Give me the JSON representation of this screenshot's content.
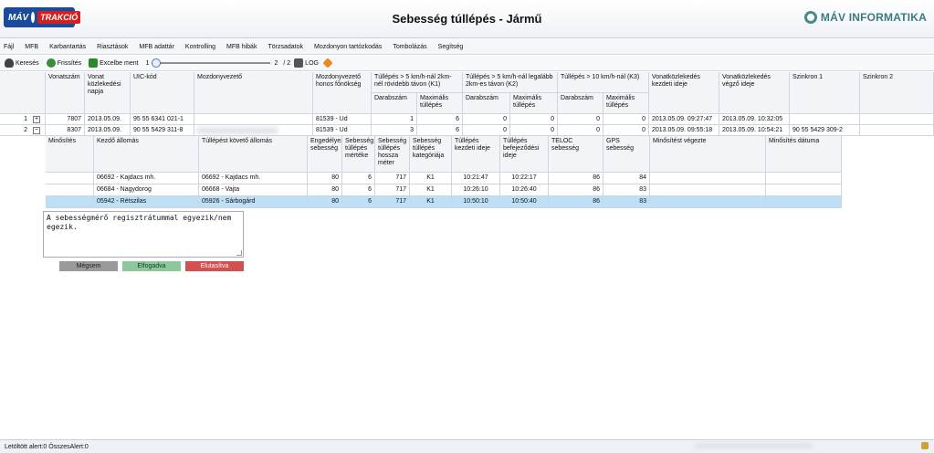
{
  "header": {
    "logo_left_mav": "MÁV",
    "logo_left_trakcio": "TRAKCIÓ",
    "title": "Sebesség túllépés - Jármű",
    "logo_right": "MÁV INFORMATIKA"
  },
  "menu": [
    "Fájl",
    "MFB",
    "Karbantartás",
    "Riasztások",
    "MFB adattár",
    "Kontrolling",
    "MFB hibák",
    "Törzsadatok",
    "Mozdonyon tartózkodás",
    "Tombolázás",
    "Segítség"
  ],
  "toolbar": {
    "search": "Keresés",
    "refresh": "Frissítés",
    "excel": "Excelbe ment",
    "page_current": "1",
    "page_total": "2",
    "page_of": "/ 2",
    "log": "LOG"
  },
  "main_grid": {
    "headers": {
      "vonatszam": "Vonatszám",
      "vonat_napja": "Vonat közlekedési napja",
      "uic": "UIC-kód",
      "mozdonyvezeto": "Mozdonyvezető",
      "fonokseg": "Mozdonyvezető honos főnökség",
      "k1_group": "Túllépés > 5 km/h-nál 2km-nél rövidebb távon (K1)",
      "k2_group": "Túllépés > 5 km/h-nál legalább 2km-es távon (K2)",
      "k3_group": "Túllépés > 10 km/h-nál (K3)",
      "darabszam": "Darabszám",
      "max_tullepes": "Maximális túllépés",
      "kezdeti": "Vonatközlekedés kezdeti ideje",
      "vegzo": "Vonatközlekedés végző ideje",
      "szinkron1": "Szinkron 1",
      "szinkron2": "Szinkron 2"
    },
    "rows": [
      {
        "num": "1",
        "expander": "+",
        "vonatszam": "7807",
        "nap": "2013.05.09.",
        "uic": "95 55 6341 021-1",
        "fonokseg": "81539 - Ud",
        "k1_db": "1",
        "k1_max": "6",
        "k2_db": "0",
        "k2_max": "0",
        "k3_db": "0",
        "k3_max": "0",
        "kezdeti": "2013.05.09. 09:27:47",
        "vegzo": "2013.05.09. 10:32:05",
        "szinkron1": "",
        "szinkron2": ""
      },
      {
        "num": "2",
        "expander": "−",
        "vonatszam": "8307",
        "nap": "2013.05.09.",
        "uic": "90 55 5429 311-8",
        "fonokseg": "81539 - Ud",
        "k1_db": "3",
        "k1_max": "6",
        "k2_db": "0",
        "k2_max": "0",
        "k3_db": "0",
        "k3_max": "0",
        "kezdeti": "2013.05.09. 09:55:18",
        "vegzo": "2013.05.09. 10:54:21",
        "szinkron1": "90 55 5429 309-2",
        "szinkron2": ""
      }
    ]
  },
  "detail_grid": {
    "headers": {
      "minosites": "Minősítés",
      "kezdo": "Kezdő állomás",
      "koveto": "Túllépést követő állomás",
      "engedelyezett": "Engedélyezett sebesség",
      "mertek": "Sebesség túllépés mértéke",
      "hossz": "Sebesség túllépés hossza méter",
      "kategoria": "Sebesség túllépés kategóriája",
      "kezdeti": "Túllépés kezdeti ideje",
      "befejezo": "Túllépés befejeződési ideje",
      "teloc": "TELOC sebesség",
      "gps": "GPS sebesség",
      "vegezte": "Minősítést végezte",
      "datum": "Minősítés dátuma"
    },
    "rows": [
      {
        "minosites": "",
        "kezdo": "06692 - Kajdacs mh.",
        "koveto": "06692 - Kajdacs mh.",
        "eng": "80",
        "mertek": "6",
        "hossz": "717",
        "kat": "K1",
        "kezdeti": "10:21:47",
        "befejezo": "10:22:17",
        "teloc": "86",
        "gps": "84",
        "vegezte": "",
        "datum": ""
      },
      {
        "minosites": "",
        "kezdo": "06684 - Nagydorog",
        "koveto": "06668 - Vajta",
        "eng": "80",
        "mertek": "6",
        "hossz": "717",
        "kat": "K1",
        "kezdeti": "10:26:10",
        "befejezo": "10:26:40",
        "teloc": "86",
        "gps": "83",
        "vegezte": "",
        "datum": ""
      },
      {
        "minosites": "",
        "kezdo": "05942 - Rétszilas",
        "koveto": "05926 - Sárbogárd",
        "eng": "80",
        "mertek": "6",
        "hossz": "717",
        "kat": "K1",
        "kezdeti": "10:50:10",
        "befejezo": "10:50:40",
        "teloc": "86",
        "gps": "83",
        "vegezte": "",
        "datum": ""
      }
    ]
  },
  "notes_text": "A sebességmérő regisztrátummal egyezik/nem\negezik.",
  "actions": {
    "cancel": "Mégsem",
    "accept": "Elfogadva",
    "reject": "Elutasítva"
  },
  "status": {
    "text": "Letöltött alert:0 ÖsszesAlert:0"
  },
  "colors": {
    "header_blue": "#1a4b9b",
    "trakcio_red": "#d31f1f",
    "accept_green": "#8bc89a",
    "reject_red": "#d35050",
    "selected_row": "#bde0f7"
  }
}
